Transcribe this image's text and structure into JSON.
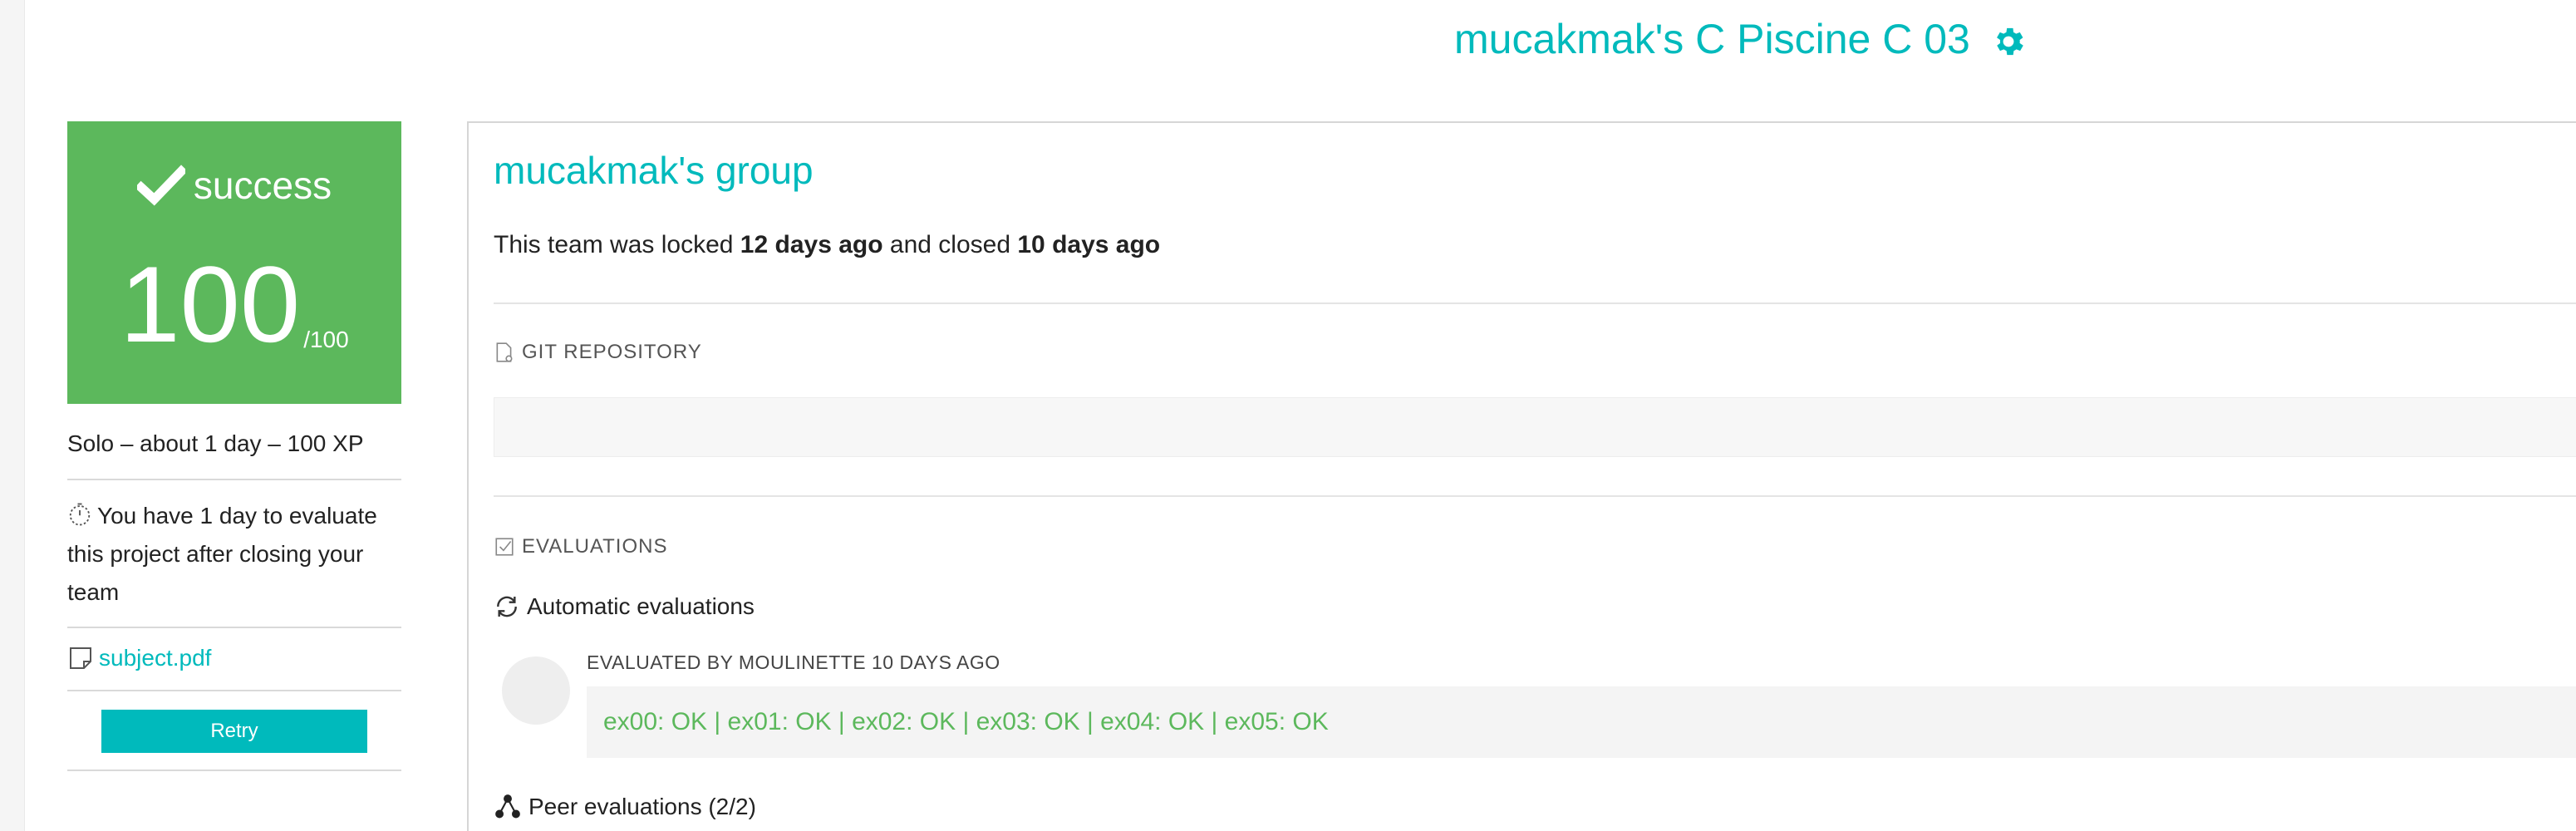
{
  "header": {
    "project_title": "mucakmak's C Piscine C 03",
    "settings_icon": "gear-icon"
  },
  "sidebar": {
    "status": "success",
    "score": "100",
    "score_max": "/100",
    "meta": "Solo – about 1 day – 100 XP",
    "notice": "You have 1 day to evaluate this project after closing your team",
    "subject_link": "subject.pdf",
    "retry_label": "Retry"
  },
  "main": {
    "group_title": "mucakmak's group",
    "team_prefix": "This team was locked",
    "locked_ago": "12 days ago",
    "team_mid": "and closed",
    "closed_ago": "10 days ago",
    "git_label": "GIT REPOSITORY",
    "evaluations_label": "EVALUATIONS",
    "auto_label": "Automatic evaluations",
    "evaluated_by": "EVALUATED BY MOULINETTE 10 DAYS AGO",
    "eval_result": "ex00: OK | ex01: OK | ex02: OK | ex03: OK | ex04: OK | ex05: OK",
    "peer_label": "Peer evaluations (2/2)"
  },
  "colors": {
    "accent": "#00babc",
    "success": "#5cb85c"
  }
}
